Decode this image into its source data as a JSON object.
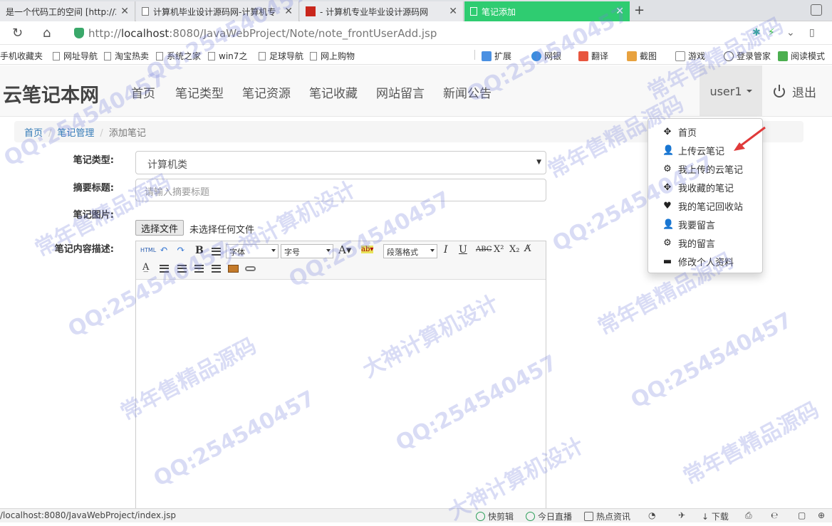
{
  "browser": {
    "tabs": [
      {
        "title": "是一个代码工的空间 [http://2",
        "active": false
      },
      {
        "title": "计算机毕业设计源码网-计算机专",
        "active": false
      },
      {
        "title": "- 计算机专业毕业设计源码网",
        "active": false
      },
      {
        "title": "笔记添加",
        "active": true
      }
    ],
    "new_tab": "+",
    "url_scheme": "http://",
    "url_host": "localhost",
    "url_rest": ":8080/JavaWebProject/Note/note_frontUserAdd.jsp",
    "bookmarks": [
      "手机收藏夹",
      "网址导航",
      "淘宝热卖",
      "系统之家",
      "win7之",
      "足球导航",
      "网上购物"
    ],
    "extensions": [
      "扩展",
      "网银",
      "翻译",
      "截图",
      "游戏",
      "登录管家",
      "阅读模式"
    ],
    "status_url": "/localhost:8080/JavaWebProject/index.jsp",
    "status_items": [
      "快剪辑",
      "今日直播",
      "热点资讯",
      "下载"
    ]
  },
  "site": {
    "brand": "云笔记本网",
    "nav": [
      "首页",
      "笔记类型",
      "笔记资源",
      "笔记收藏",
      "网站留言",
      "新闻公告"
    ],
    "user": "user1",
    "logout": "退出"
  },
  "breadcrumb": {
    "home": "首页",
    "section": "笔记管理",
    "current": "添加笔记"
  },
  "form": {
    "type_label": "笔记类型:",
    "type_value": "计算机类",
    "title_label": "摘要标题:",
    "title_placeholder": "请输入摘要标题",
    "image_label": "笔记图片:",
    "file_button": "选择文件",
    "file_status": "未选择任何文件",
    "content_label": "笔记内容描述:"
  },
  "editor": {
    "html_btn": "HTML",
    "font_select": "字体",
    "size_select": "字号",
    "para_select": "段落格式"
  },
  "user_menu": [
    {
      "icon": "move-icon",
      "glyph": "✥",
      "label": "首页"
    },
    {
      "icon": "user-icon",
      "glyph": "👤",
      "label": "上传云笔记"
    },
    {
      "icon": "cog-icon",
      "glyph": "⚙",
      "label": "我上传的云笔记"
    },
    {
      "icon": "move-icon",
      "glyph": "✥",
      "label": "我收藏的笔记"
    },
    {
      "icon": "heart-icon",
      "glyph": "♥",
      "label": "我的笔记回收站"
    },
    {
      "icon": "user-icon",
      "glyph": "👤",
      "label": "我要留言"
    },
    {
      "icon": "cog-icon",
      "glyph": "⚙",
      "label": "我的留言"
    },
    {
      "icon": "credit-card-icon",
      "glyph": "▬",
      "label": "修改个人资料"
    }
  ],
  "watermarks": [
    "QQ:254540457",
    "常年售精品源码",
    "大神计算机设计"
  ],
  "colors": {
    "active_tab": "#2fcc71",
    "link": "#337ab7",
    "watermark": "#7882dc",
    "arrow": "#e03a3a"
  }
}
